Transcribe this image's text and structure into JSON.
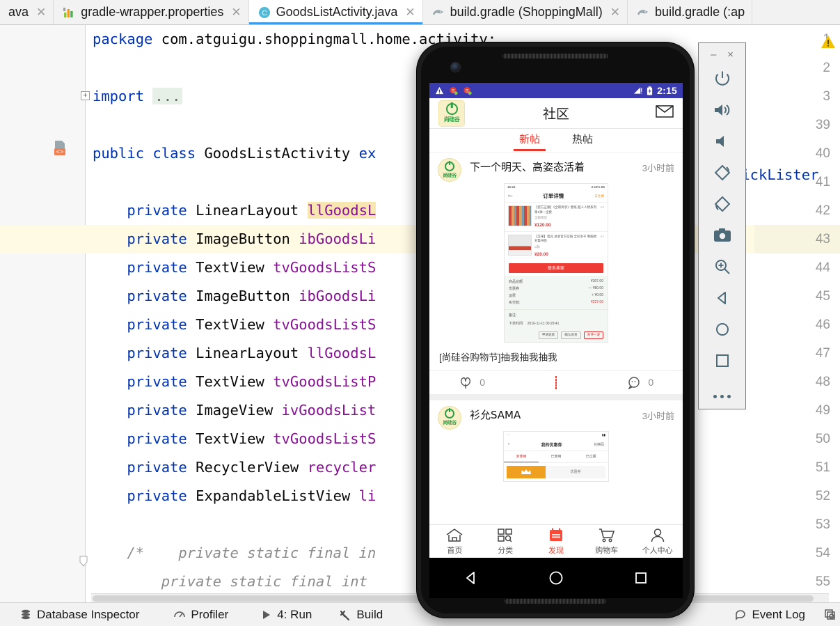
{
  "tabs": [
    {
      "label": "ava",
      "icon": "java-file-icon",
      "active": false,
      "closable": true,
      "truncated_left": true
    },
    {
      "label": "gradle-wrapper.properties",
      "icon": "properties-file-icon",
      "active": false,
      "closable": true
    },
    {
      "label": "GoodsListActivity.java",
      "icon": "java-class-icon",
      "active": true,
      "closable": true
    },
    {
      "label": "build.gradle (ShoppingMall)",
      "icon": "gradle-file-icon",
      "active": false,
      "closable": true
    },
    {
      "label": "build.gradle (:ap",
      "icon": "gradle-file-icon",
      "active": false,
      "closable": false
    }
  ],
  "editor": {
    "lines": [
      {
        "num": "1",
        "current": false,
        "segments": [
          {
            "t": "package ",
            "c": "kw"
          },
          {
            "t": "com.atguigu.shoppingmall.home.activity;",
            "c": "plain"
          }
        ]
      },
      {
        "num": "2",
        "current": false,
        "segments": []
      },
      {
        "num": "3",
        "current": false,
        "fold": true,
        "segments": [
          {
            "t": "import ",
            "c": "kw"
          },
          {
            "t": "...",
            "c": "fold"
          }
        ]
      },
      {
        "num": "39",
        "current": false,
        "segments": []
      },
      {
        "num": "40",
        "current": false,
        "gutter_icon": "class-marker-icon",
        "segments": [
          {
            "t": "public class ",
            "c": "kw"
          },
          {
            "t": "GoodsListActivity ",
            "c": "plain"
          },
          {
            "t": "ex",
            "c": "kw"
          }
        ]
      },
      {
        "num": "41",
        "current": false,
        "segments": []
      },
      {
        "num": "42",
        "current": false,
        "segments": [
          {
            "t": "    private ",
            "c": "kw"
          },
          {
            "t": "LinearLayout ",
            "c": "plain"
          },
          {
            "t": "llGoodsL",
            "c": "hlfield"
          }
        ]
      },
      {
        "num": "43",
        "current": true,
        "segments": [
          {
            "t": "    private ",
            "c": "kw"
          },
          {
            "t": "ImageButton ",
            "c": "plain"
          },
          {
            "t": "ibGoodsLi",
            "c": "fld"
          }
        ]
      },
      {
        "num": "44",
        "current": false,
        "segments": [
          {
            "t": "    private ",
            "c": "kw"
          },
          {
            "t": "TextView ",
            "c": "plain"
          },
          {
            "t": "tvGoodsListS",
            "c": "fld"
          }
        ]
      },
      {
        "num": "45",
        "current": false,
        "segments": [
          {
            "t": "    private ",
            "c": "kw"
          },
          {
            "t": "ImageButton ",
            "c": "plain"
          },
          {
            "t": "ibGoodsLi",
            "c": "fld"
          }
        ]
      },
      {
        "num": "46",
        "current": false,
        "segments": [
          {
            "t": "    private ",
            "c": "kw"
          },
          {
            "t": "TextView ",
            "c": "plain"
          },
          {
            "t": "tvGoodsListS",
            "c": "fld"
          }
        ]
      },
      {
        "num": "47",
        "current": false,
        "segments": [
          {
            "t": "    private ",
            "c": "kw"
          },
          {
            "t": "LinearLayout ",
            "c": "plain"
          },
          {
            "t": "llGoodsL",
            "c": "fld"
          }
        ]
      },
      {
        "num": "48",
        "current": false,
        "segments": [
          {
            "t": "    private ",
            "c": "kw"
          },
          {
            "t": "TextView ",
            "c": "plain"
          },
          {
            "t": "tvGoodsListP",
            "c": "fld"
          }
        ]
      },
      {
        "num": "49",
        "current": false,
        "segments": [
          {
            "t": "    private ",
            "c": "kw"
          },
          {
            "t": "ImageView ",
            "c": "plain"
          },
          {
            "t": "ivGoodsList",
            "c": "fld"
          }
        ]
      },
      {
        "num": "50",
        "current": false,
        "segments": [
          {
            "t": "    private ",
            "c": "kw"
          },
          {
            "t": "TextView ",
            "c": "plain"
          },
          {
            "t": "tvGoodsListS",
            "c": "fld"
          }
        ]
      },
      {
        "num": "51",
        "current": false,
        "segments": [
          {
            "t": "    private ",
            "c": "kw"
          },
          {
            "t": "RecyclerView ",
            "c": "plain"
          },
          {
            "t": "recycler",
            "c": "fld"
          }
        ]
      },
      {
        "num": "52",
        "current": false,
        "segments": [
          {
            "t": "    private ",
            "c": "kw"
          },
          {
            "t": "ExpandableListView ",
            "c": "plain"
          },
          {
            "t": "li",
            "c": "fld"
          }
        ]
      },
      {
        "num": "53",
        "current": false,
        "segments": []
      },
      {
        "num": "54",
        "current": false,
        "foldarrow": true,
        "segments": [
          {
            "t": "    /*    private static final in",
            "c": "cmt"
          }
        ]
      },
      {
        "num": "55",
        "current": false,
        "segments": [
          {
            "t": "        private static final int ",
            "c": "cmt"
          }
        ]
      }
    ],
    "overflow_text": "lickLister",
    "warning_icon": "warning-triangle-icon"
  },
  "statusbar": {
    "left_items": [
      {
        "label": "Database Inspector",
        "icon": "database-icon"
      },
      {
        "label": "Profiler",
        "icon": "profiler-icon"
      },
      {
        "label": "4: Run",
        "icon": "run-play-icon",
        "accel": "4"
      },
      {
        "label": "Build",
        "icon": "build-hammer-icon"
      }
    ],
    "right_items": [
      {
        "label": "Event Log",
        "icon": "event-log-icon"
      },
      {
        "label": "",
        "icon": "layout-inspector-icon"
      }
    ]
  },
  "emulator": {
    "window_controls": [
      {
        "name": "minimize",
        "glyph": "–"
      },
      {
        "name": "close",
        "glyph": "×"
      }
    ],
    "buttons": [
      {
        "name": "power-icon",
        "tooltip": "Power"
      },
      {
        "name": "volume-up-icon",
        "tooltip": "Volume Up"
      },
      {
        "name": "volume-down-icon",
        "tooltip": "Volume Down"
      },
      {
        "name": "rotate-left-icon",
        "tooltip": "Rotate Left"
      },
      {
        "name": "rotate-right-icon",
        "tooltip": "Rotate Right"
      },
      {
        "name": "screenshot-camera-icon",
        "tooltip": "Take Screenshot"
      },
      {
        "name": "zoom-in-icon",
        "tooltip": "Zoom Mode"
      },
      {
        "name": "back-triangle-icon",
        "tooltip": "Back"
      },
      {
        "name": "home-circle-icon",
        "tooltip": "Home"
      },
      {
        "name": "overview-square-icon",
        "tooltip": "Overview"
      },
      {
        "name": "more-dots-icon",
        "tooltip": "More"
      }
    ]
  },
  "android": {
    "status": {
      "time": "2:15",
      "icons": [
        "warning-icon",
        "app-notification-icon",
        "app-notification-icon"
      ],
      "right_icons": [
        "signal-icon",
        "battery-icon"
      ]
    },
    "header": {
      "title": "社区",
      "logo_text": "尚硅谷",
      "mail_icon": "mail-envelope-icon"
    },
    "tabs": [
      {
        "label": "新帖",
        "active": true
      },
      {
        "label": "热帖",
        "active": false
      }
    ],
    "posts": [
      {
        "user": "下一个明天、高姿态活着",
        "time": "3小时前",
        "caption": "[尚硅谷购物节]抽我抽我抽我",
        "likes": "0",
        "comments": "0",
        "screenshot": {
          "type": "order-detail",
          "status_left": "15:22",
          "status_right": "2.22% 56",
          "title": "订单详情",
          "corner_label": "去吐槽",
          "items": [
            {
              "desc": "【官方正版】《全职高手》壁纸 超人人物系列第1弹—全套",
              "sku": "全部现货",
              "qty": "×1",
              "price": "¥120.00"
            },
            {
              "desc": "【又来】电竞 总会官方信纸 全彩亲子 制服款 对集书签",
              "sku": "C款",
              "qty": "×1",
              "price": "¥20.00"
            }
          ],
          "action_button": "联系卖家",
          "summary": [
            {
              "label": "商品总额",
              "value": "¥307.00"
            },
            {
              "label": "优惠券",
              "value": "— ¥80.00"
            },
            {
              "label": "运费",
              "value": "+ ¥0.00"
            },
            {
              "label": "实付款:",
              "value": "¥227.00",
              "highlight": true
            }
          ],
          "note_label": "备注:",
          "order_time_label": "下单时间:",
          "order_time": "2016-11-11 00:29:41",
          "buttons": [
            "申请退款",
            "确认收货",
            "去评一波"
          ]
        }
      },
      {
        "user": "衫允SAMA",
        "time": "3小时前",
        "screenshot": {
          "type": "coupon-list",
          "title": "我的优惠券",
          "right_label": "兑换码",
          "tabs": [
            "未使用",
            "已使用",
            "已过期"
          ],
          "card_label": "优惠券"
        }
      }
    ],
    "bottom_nav": [
      {
        "label": "首页",
        "icon": "home-icon",
        "active": false
      },
      {
        "label": "分类",
        "icon": "category-grid-icon",
        "active": false
      },
      {
        "label": "发现",
        "icon": "discover-calendar-icon",
        "active": true
      },
      {
        "label": "购物车",
        "icon": "cart-icon",
        "active": false
      },
      {
        "label": "个人中心",
        "icon": "person-icon",
        "active": false
      }
    ],
    "system_nav": [
      {
        "name": "back-button",
        "icon": "triangle-back-icon"
      },
      {
        "name": "home-button",
        "icon": "circle-home-icon"
      },
      {
        "name": "recents-button",
        "icon": "square-recents-icon"
      }
    ]
  },
  "colors": {
    "accent_blue": "#3d9be9",
    "android_statusbar": "#3b3bb0",
    "tab_accent_red": "#e8392f",
    "nav_active": "#fb4a38",
    "keyword": "#0033b3",
    "field": "#871094",
    "comment": "#8c8c8c"
  }
}
